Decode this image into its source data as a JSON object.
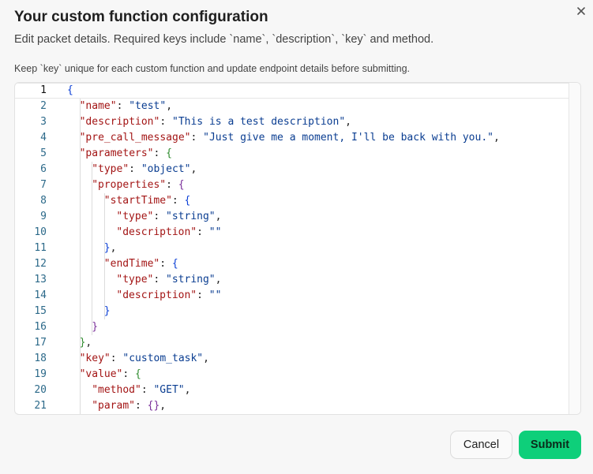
{
  "dialog": {
    "title": "Your custom function configuration",
    "subtitle": "Edit packet details. Required keys include `name`, `description`, `key` and method.",
    "hint": "Keep `key` unique for each custom function and update endpoint details before submitting.",
    "close_icon": "close-icon"
  },
  "editor": {
    "active_line": 1,
    "line_numbers": [
      "1",
      "2",
      "3",
      "4",
      "5",
      "6",
      "7",
      "8",
      "9",
      "10",
      "11",
      "12",
      "13",
      "14",
      "15",
      "16",
      "17",
      "18",
      "19",
      "20",
      "21"
    ],
    "lines": [
      [
        [
          "{",
          "b1"
        ]
      ],
      [
        [
          "\"name\"",
          "k"
        ],
        [
          ": ",
          "p"
        ],
        [
          "\"test\"",
          "s"
        ],
        [
          ",",
          "p"
        ]
      ],
      [
        [
          "\"description\"",
          "k"
        ],
        [
          ": ",
          "p"
        ],
        [
          "\"This is a test description\"",
          "s"
        ],
        [
          ",",
          "p"
        ]
      ],
      [
        [
          "\"pre_call_message\"",
          "k"
        ],
        [
          ": ",
          "p"
        ],
        [
          "\"Just give me a moment, I'll be back with you.\"",
          "s"
        ],
        [
          ",",
          "p"
        ]
      ],
      [
        [
          "\"parameters\"",
          "k"
        ],
        [
          ": ",
          "p"
        ],
        [
          "{",
          "b2"
        ]
      ],
      [
        [
          "\"type\"",
          "k"
        ],
        [
          ": ",
          "p"
        ],
        [
          "\"object\"",
          "s"
        ],
        [
          ",",
          "p"
        ]
      ],
      [
        [
          "\"properties\"",
          "k"
        ],
        [
          ": ",
          "p"
        ],
        [
          "{",
          "b3"
        ]
      ],
      [
        [
          "\"startTime\"",
          "k"
        ],
        [
          ": ",
          "p"
        ],
        [
          "{",
          "b1"
        ]
      ],
      [
        [
          "\"type\"",
          "k"
        ],
        [
          ": ",
          "p"
        ],
        [
          "\"string\"",
          "s"
        ],
        [
          ",",
          "p"
        ]
      ],
      [
        [
          "\"description\"",
          "k"
        ],
        [
          ": ",
          "p"
        ],
        [
          "\"\"",
          "s"
        ]
      ],
      [
        [
          "}",
          "b1"
        ],
        [
          ",",
          "p"
        ]
      ],
      [
        [
          "\"endTime\"",
          "k"
        ],
        [
          ": ",
          "p"
        ],
        [
          "{",
          "b1"
        ]
      ],
      [
        [
          "\"type\"",
          "k"
        ],
        [
          ": ",
          "p"
        ],
        [
          "\"string\"",
          "s"
        ],
        [
          ",",
          "p"
        ]
      ],
      [
        [
          "\"description\"",
          "k"
        ],
        [
          ": ",
          "p"
        ],
        [
          "\"\"",
          "s"
        ]
      ],
      [
        [
          "}",
          "b1"
        ]
      ],
      [
        [
          "}",
          "b3"
        ]
      ],
      [
        [
          "}",
          "b2"
        ],
        [
          ",",
          "p"
        ]
      ],
      [
        [
          "\"key\"",
          "k"
        ],
        [
          ": ",
          "p"
        ],
        [
          "\"custom_task\"",
          "s"
        ],
        [
          ",",
          "p"
        ]
      ],
      [
        [
          "\"value\"",
          "k"
        ],
        [
          ": ",
          "p"
        ],
        [
          "{",
          "b2"
        ]
      ],
      [
        [
          "\"method\"",
          "k"
        ],
        [
          ": ",
          "p"
        ],
        [
          "\"GET\"",
          "s"
        ],
        [
          ",",
          "p"
        ]
      ],
      [
        [
          "\"param\"",
          "k"
        ],
        [
          ": ",
          "p"
        ],
        [
          "{}",
          "b3"
        ],
        [
          ",",
          "p"
        ]
      ]
    ]
  },
  "footer": {
    "cancel_label": "Cancel",
    "submit_label": "Submit"
  }
}
